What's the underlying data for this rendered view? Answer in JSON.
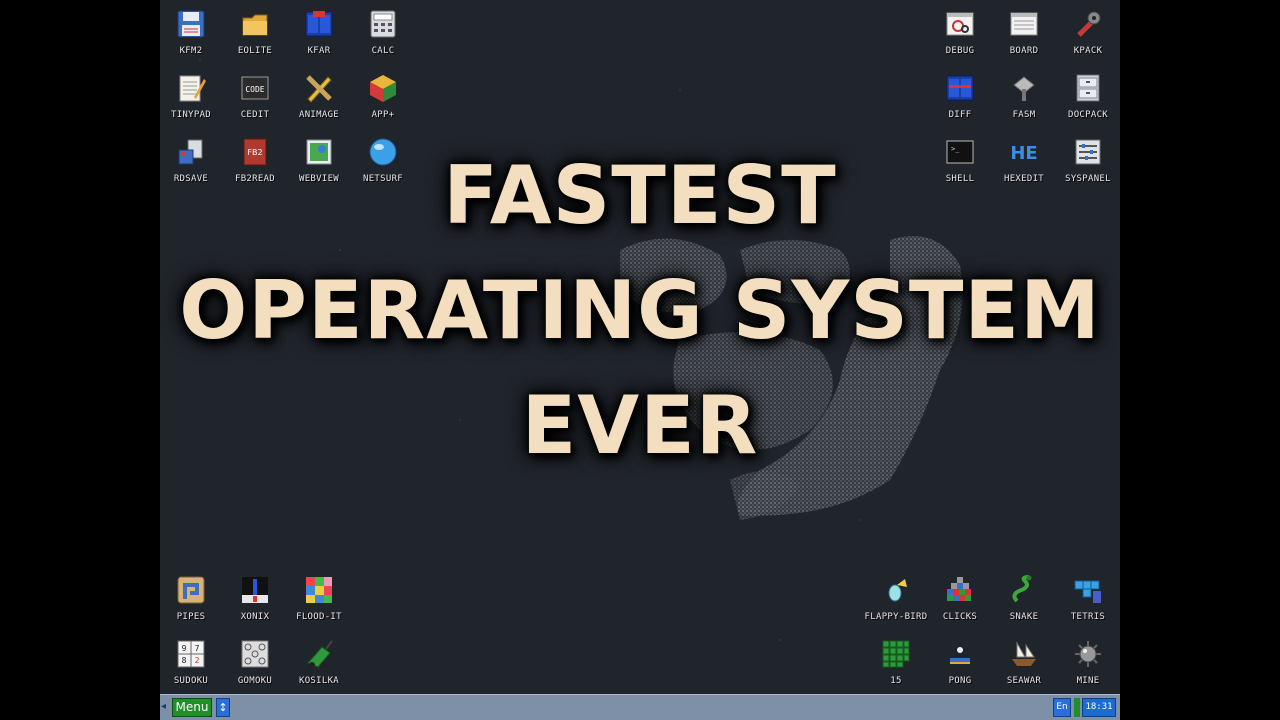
{
  "headline": {
    "line1": "FASTEST",
    "line2": "OPERATING SYSTEM",
    "line3": "EVER"
  },
  "icons_top_left": [
    {
      "label": "KFM2",
      "icon": "floppy-icon"
    },
    {
      "label": "EOLITE",
      "icon": "folder-icon"
    },
    {
      "label": "KFAR",
      "icon": "dual-panel-icon"
    },
    {
      "label": "CALC",
      "icon": "calculator-icon"
    },
    {
      "label": "TINYPAD",
      "icon": "notepad-icon"
    },
    {
      "label": "CEDIT",
      "icon": "code-icon"
    },
    {
      "label": "ANIMAGE",
      "icon": "pencil-ruler-icon"
    },
    {
      "label": "APP+",
      "icon": "cube-icon"
    },
    {
      "label": "RDSAVE",
      "icon": "rdsave-icon"
    },
    {
      "label": "FB2READ",
      "icon": "book-icon"
    },
    {
      "label": "WEBVIEW",
      "icon": "map-icon"
    },
    {
      "label": "NETSURF",
      "icon": "globe-icon"
    }
  ],
  "icons_top_right": [
    {
      "label": "DEBUG",
      "icon": "debug-icon"
    },
    {
      "label": "BOARD",
      "icon": "board-icon"
    },
    {
      "label": "KPACK",
      "icon": "wrench-icon"
    },
    {
      "label": "DIFF",
      "icon": "diff-icon"
    },
    {
      "label": "FASM",
      "icon": "fasm-icon"
    },
    {
      "label": "DOCPACK",
      "icon": "cabinet-icon"
    },
    {
      "label": "SHELL",
      "icon": "terminal-icon"
    },
    {
      "label": "HEXEDIT",
      "icon": "hex-icon"
    },
    {
      "label": "SYSPANEL",
      "icon": "sliders-icon"
    }
  ],
  "icons_bottom_left": [
    {
      "label": "PIPES",
      "icon": "pipes-icon"
    },
    {
      "label": "XONIX",
      "icon": "xonix-icon"
    },
    {
      "label": "FLOOD-IT",
      "icon": "flood-icon"
    },
    {
      "label": "SUDOKU",
      "icon": "sudoku-icon",
      "text": "9 7 2"
    },
    {
      "label": "GOMOKU",
      "icon": "gomoku-icon"
    },
    {
      "label": "KOSILKA",
      "icon": "mower-icon"
    }
  ],
  "icons_bottom_right": [
    {
      "label": "FLAPPY-BIRD",
      "icon": "bird-icon"
    },
    {
      "label": "CLICKS",
      "icon": "blocks-icon"
    },
    {
      "label": "SNAKE",
      "icon": "snake-icon"
    },
    {
      "label": "TETRIS",
      "icon": "tetris-icon"
    },
    {
      "label": "15",
      "icon": "fifteen-icon"
    },
    {
      "label": "PONG",
      "icon": "pong-icon"
    },
    {
      "label": "SEAWAR",
      "icon": "ship-icon"
    },
    {
      "label": "MINE",
      "icon": "mine-icon"
    }
  ],
  "icon_text": {
    "cedit": "CODE",
    "fb2read": "FB2",
    "hexedit": "HE",
    "shell": ">_"
  },
  "taskbar": {
    "menu_label": "Menu",
    "lang": "En",
    "clock": "18:31",
    "switch_glyph": "↕",
    "left_arrow": "◂"
  },
  "colors": {
    "desktop": "#20242b",
    "taskbar": "#7e8fa8",
    "menu_button": "#1f8f2a",
    "headline": "#f3dfbf",
    "clock_bg": "#1c6bd1"
  }
}
